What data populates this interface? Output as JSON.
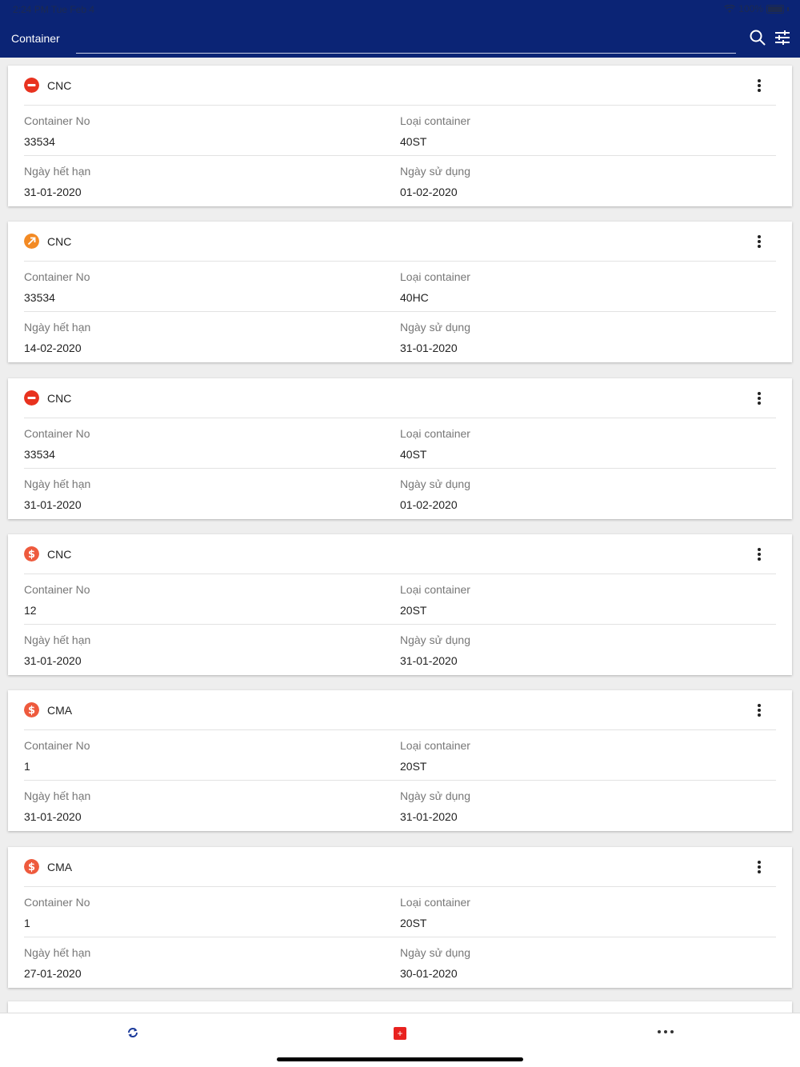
{
  "status_bar": {
    "time": "2:24 PM  Tue Feb 4",
    "battery": "100%"
  },
  "header": {
    "title": "Container",
    "search_placeholder": ""
  },
  "colors": {
    "header_bg": "#0b2475",
    "stop_red": "#e8321f",
    "arrow_orange": "#f38a24",
    "dollar_red": "#ee5a3d"
  },
  "labels": {
    "container_no": "Container No",
    "container_type": "Loại container",
    "expiry_date": "Ngày hết hạn",
    "use_date": "Ngày sử dụng"
  },
  "cards": [
    {
      "icon": "stop-icon",
      "name": "CNC",
      "container_no": "33534",
      "container_type": "40ST",
      "expiry_date": "31-01-2020",
      "use_date": "01-02-2020"
    },
    {
      "icon": "arrow-up-right-icon",
      "name": "CNC",
      "container_no": "33534",
      "container_type": "40HC",
      "expiry_date": "14-02-2020",
      "use_date": "31-01-2020"
    },
    {
      "icon": "stop-icon",
      "name": "CNC",
      "container_no": "33534",
      "container_type": "40ST",
      "expiry_date": "31-01-2020",
      "use_date": "01-02-2020"
    },
    {
      "icon": "dollar-icon",
      "name": "CNC",
      "container_no": "12",
      "container_type": "20ST",
      "expiry_date": "31-01-2020",
      "use_date": "31-01-2020"
    },
    {
      "icon": "dollar-icon",
      "name": "CMA",
      "container_no": "1",
      "container_type": "20ST",
      "expiry_date": "31-01-2020",
      "use_date": "31-01-2020"
    },
    {
      "icon": "dollar-icon",
      "name": "CMA",
      "container_no": "1",
      "container_type": "20ST",
      "expiry_date": "27-01-2020",
      "use_date": "30-01-2020"
    }
  ],
  "bottom_bar": {
    "refresh": "refresh-icon",
    "add": "+",
    "more": "more-icon"
  }
}
